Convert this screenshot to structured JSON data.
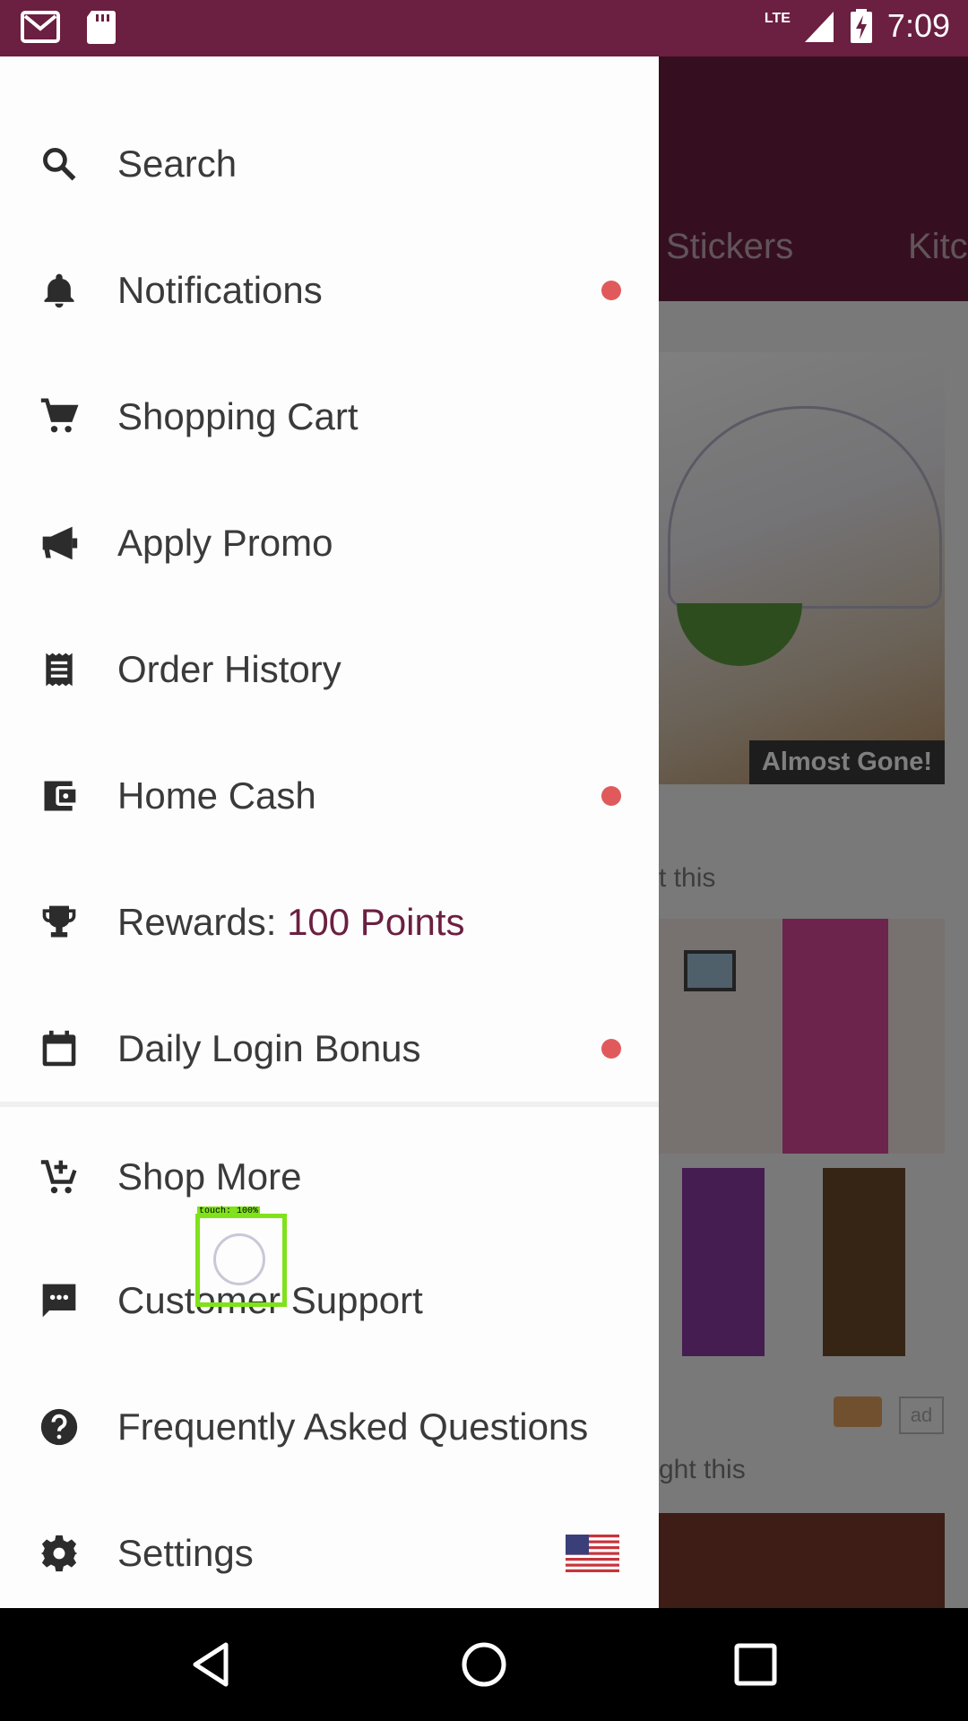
{
  "status_bar": {
    "time": "7:09",
    "network": "LTE",
    "left_icons": [
      "gmail-icon",
      "sd-card-icon"
    ],
    "right_icons": [
      "signal-icon",
      "battery-charging-icon"
    ]
  },
  "background_app": {
    "tabs": [
      "Stickers",
      "Kitc"
    ],
    "badge": "Almost Gone!",
    "text_fragment_1": "t this",
    "text_fragment_2": "ght this",
    "ad_label": "ad"
  },
  "drawer": {
    "items": [
      {
        "label": "Search",
        "icon": "search-icon",
        "dot": false
      },
      {
        "label": "Notifications",
        "icon": "bell-icon",
        "dot": true
      },
      {
        "label": "Shopping Cart",
        "icon": "cart-icon",
        "dot": false
      },
      {
        "label": "Apply Promo",
        "icon": "megaphone-icon",
        "dot": false
      },
      {
        "label": "Order History",
        "icon": "receipt-icon",
        "dot": false
      },
      {
        "label": "Home Cash",
        "icon": "wallet-icon",
        "dot": true
      },
      {
        "label": "Rewards: ",
        "value": "100 Points",
        "icon": "trophy-icon",
        "dot": false
      },
      {
        "label": "Daily Login Bonus",
        "icon": "calendar-icon",
        "dot": true
      },
      {
        "label": "Shop More",
        "icon": "add-cart-icon",
        "dot": false
      },
      {
        "label": "Customer Support",
        "icon": "chat-icon",
        "dot": false
      },
      {
        "label": "Frequently Asked Questions",
        "icon": "help-icon",
        "dot": false
      },
      {
        "label": "Settings",
        "icon": "gear-icon",
        "dot": false,
        "flag": "us-flag-icon"
      }
    ]
  },
  "touch_overlay": {
    "label": "touch: 100%"
  },
  "colors": {
    "brand": "#6b1f41",
    "dot": "#e05a5c"
  },
  "nav_bar": [
    "back-icon",
    "home-icon",
    "recents-icon"
  ]
}
